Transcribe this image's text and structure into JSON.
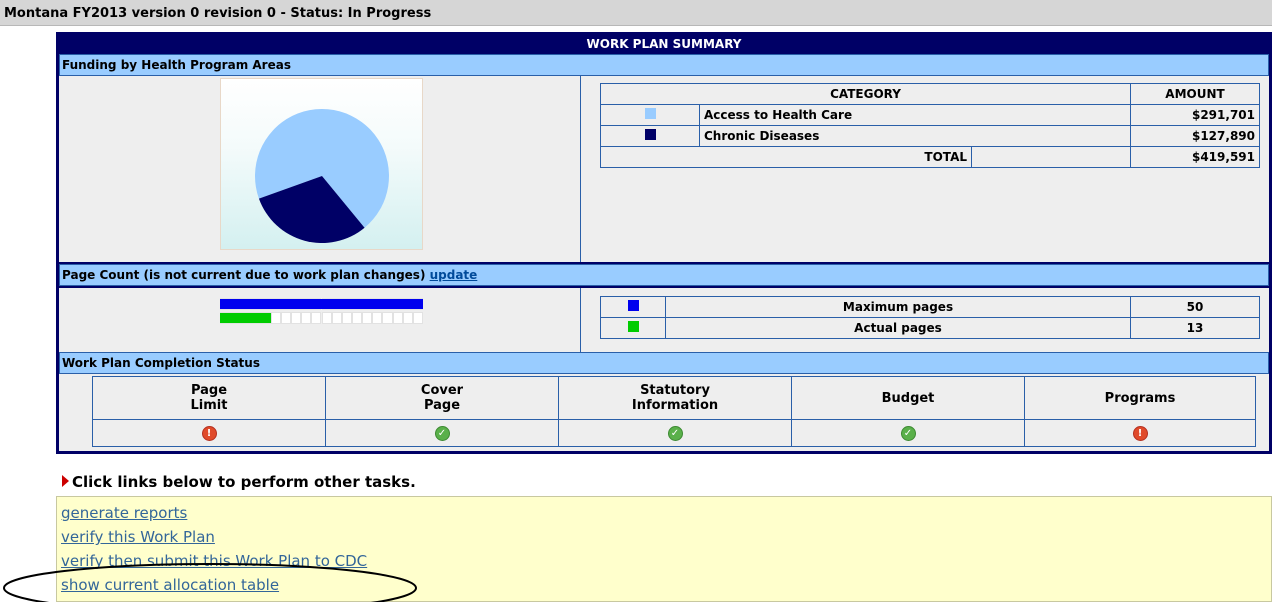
{
  "header": {
    "title": "Montana FY2013 version 0 revision 0 - Status: In Progress"
  },
  "summary": {
    "title": "WORK PLAN SUMMARY",
    "funding": {
      "section_title": "Funding by Health Program Areas",
      "columns": {
        "category": "CATEGORY",
        "amount": "AMOUNT"
      },
      "rows": [
        {
          "name": "Access to Health Care",
          "amount": "$291,701",
          "color": "#99ccff"
        },
        {
          "name": "Chronic Diseases",
          "amount": "$127,890",
          "color": "#000066"
        }
      ],
      "total_label": "TOTAL",
      "total_amount": "$419,591"
    },
    "page_count": {
      "section_title": "Page Count (is not current due to work plan changes)",
      "update_link": "update",
      "rows": [
        {
          "label": "Maximum pages",
          "value": "50",
          "color": "#0000ee"
        },
        {
          "label": "Actual pages",
          "value": "13",
          "color": "#00cc00"
        }
      ]
    },
    "completion": {
      "section_title": "Work Plan Completion Status",
      "columns": [
        {
          "label_line1": "Page",
          "label_line2": "Limit",
          "status": "error"
        },
        {
          "label_line1": "Cover",
          "label_line2": "Page",
          "status": "ok"
        },
        {
          "label_line1": "Statutory",
          "label_line2": "Information",
          "status": "ok"
        },
        {
          "label_line1": "Budget",
          "label_line2": "",
          "status": "ok"
        },
        {
          "label_line1": "Programs",
          "label_line2": "",
          "status": "error"
        }
      ]
    }
  },
  "tasks": {
    "heading": "Click links below to perform other tasks.",
    "links": [
      "generate reports",
      "verify this Work Plan",
      "verify then submit this Work Plan to CDC",
      "show current allocation table"
    ]
  },
  "chart_data": {
    "type": "pie",
    "title": "",
    "slices": [
      {
        "label": "Access to Health Care",
        "value": 291701,
        "color": "#99ccff"
      },
      {
        "label": "Chronic Diseases",
        "value": 127890,
        "color": "#000066"
      }
    ]
  }
}
